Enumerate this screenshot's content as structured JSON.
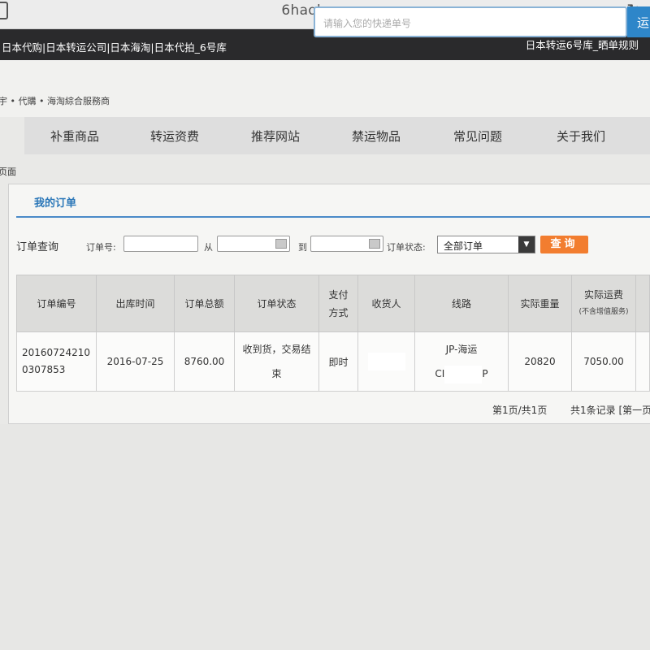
{
  "browser": {
    "url": "6haoku.com"
  },
  "topbar": {
    "left_links": "日本代购|日本转运公司|日本海淘|日本代拍_6号库",
    "right_text": "日本转运6号库_晒单规则"
  },
  "header": {
    "tagline": "宇 • 代購 • 海淘綜合服務商",
    "search_placeholder": "请输入您的快递单号",
    "search_button": "运"
  },
  "nav": {
    "items": [
      "补重商品",
      "转运资费",
      "推荐网站",
      "禁运物品",
      "常见问题",
      "关于我们"
    ]
  },
  "breadcrumb": "页面",
  "panel": {
    "title": "我的订单",
    "query": {
      "label": "订单查询",
      "order_no_label": "订单号:",
      "from_label": "从",
      "to_label": "到",
      "status_label": "订单状态:",
      "status_value": "全部订单",
      "button": "查询"
    },
    "table": {
      "headers": [
        "订单编号",
        "出库时间",
        "订单总额",
        "订单状态",
        "支付方式",
        "收货人",
        "线路",
        "实际重量",
        "实际运费"
      ],
      "freight_sub": "(不含增值服务)",
      "rows": [
        {
          "order_no": "201607242100307853",
          "out_time": "2016-07-25",
          "total": "8760.00",
          "status": "收到货，交易结束",
          "payment": "即时",
          "receiver": "",
          "route": "JP-海运",
          "route_code_prefix": "CI",
          "route_code_suffix": "P",
          "weight": "20820",
          "freight": "7050.00"
        }
      ]
    },
    "pagination": {
      "page_info": "第1页/共1页",
      "record_info": "共1条记录 [第一页"
    }
  }
}
